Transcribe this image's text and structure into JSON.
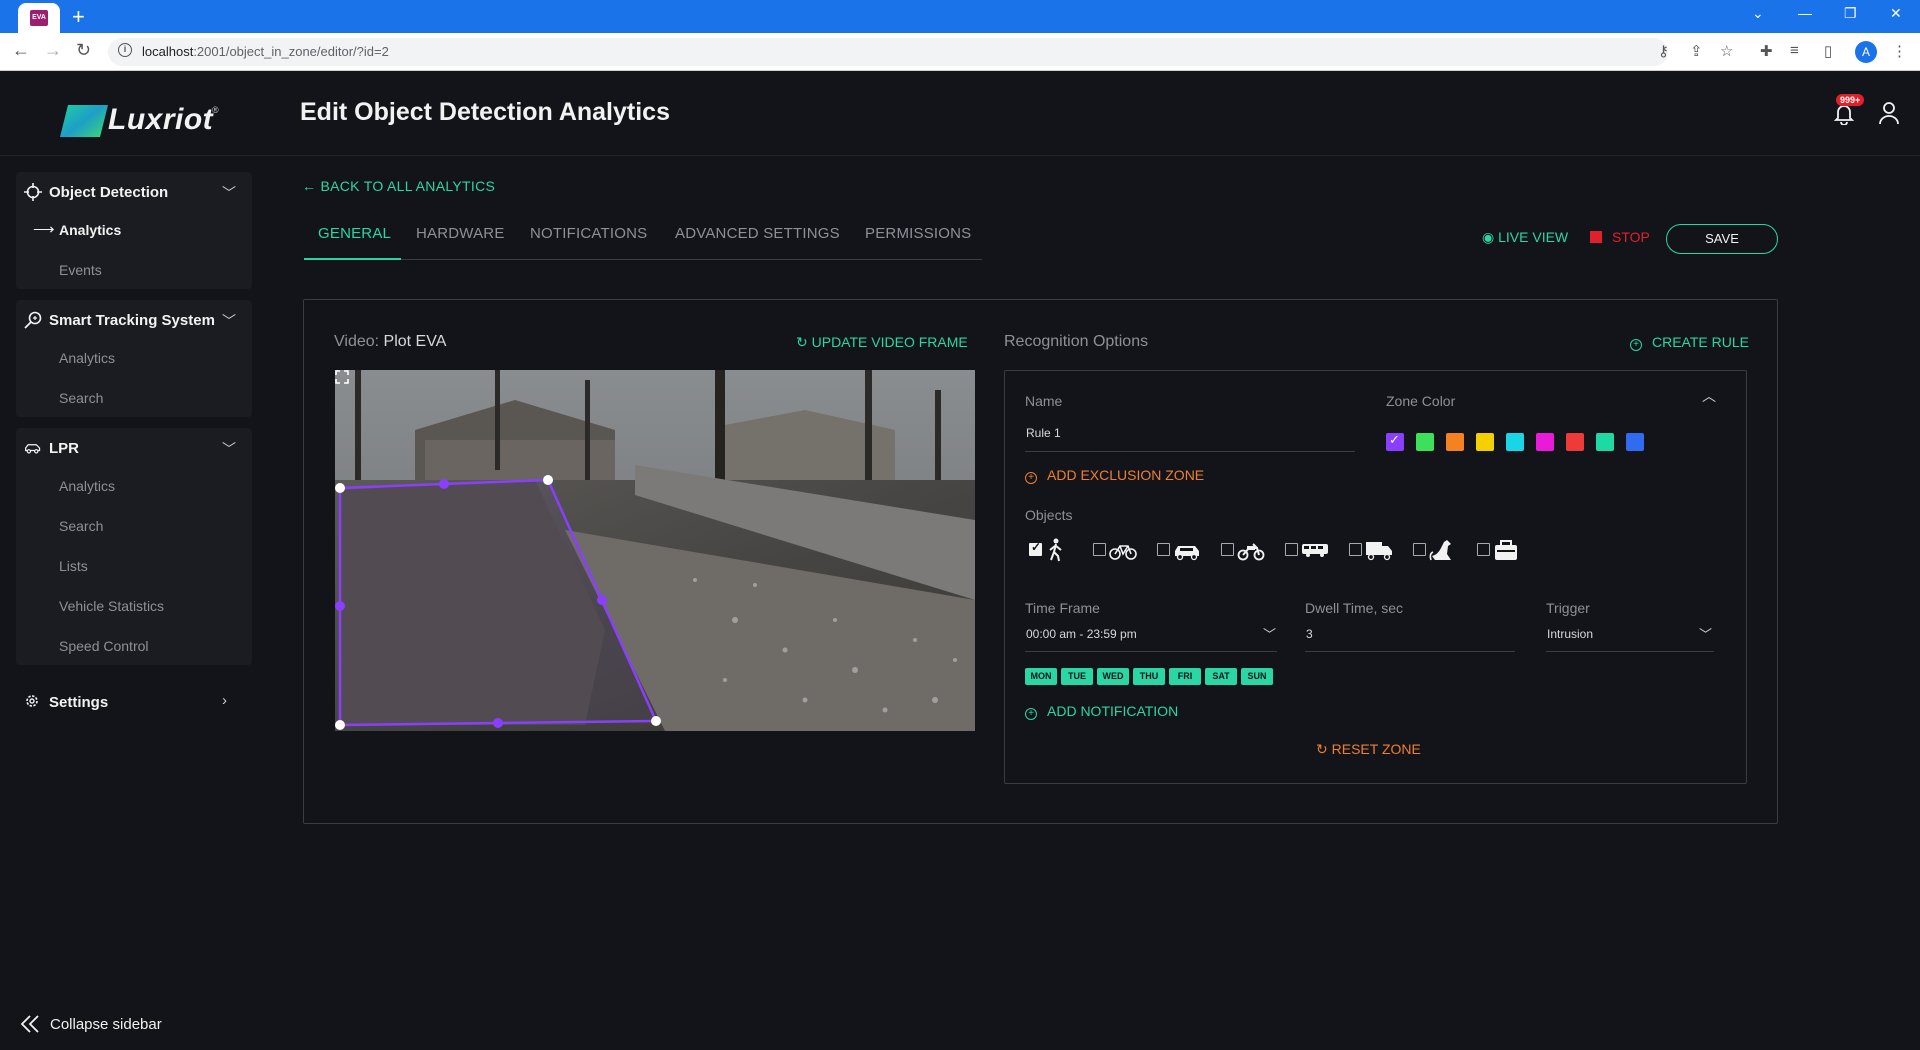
{
  "browser": {
    "tab_favicon": "EVA",
    "url_host": "localhost",
    "url_path": ":2001/object_in_zone/editor/?id=2",
    "profile_initial": "A"
  },
  "header": {
    "logo": "Luxriot",
    "title": "Edit Object Detection Analytics",
    "notification_badge": "999+"
  },
  "sidebar": {
    "groups": [
      {
        "label": "Object Detection",
        "items": [
          {
            "label": "Analytics",
            "active": true
          },
          {
            "label": "Events",
            "active": false
          }
        ]
      },
      {
        "label": "Smart Tracking System",
        "items": [
          {
            "label": "Analytics"
          },
          {
            "label": "Search"
          }
        ]
      },
      {
        "label": "LPR",
        "items": [
          {
            "label": "Analytics"
          },
          {
            "label": "Search"
          },
          {
            "label": "Lists"
          },
          {
            "label": "Vehicle Statistics"
          },
          {
            "label": "Speed Control"
          }
        ]
      }
    ],
    "settings_label": "Settings",
    "collapse_label": "Collapse sidebar"
  },
  "main": {
    "back_link": "BACK TO ALL ANALYTICS",
    "tabs": [
      {
        "label": "GENERAL",
        "active": true
      },
      {
        "label": "HARDWARE"
      },
      {
        "label": "NOTIFICATIONS"
      },
      {
        "label": "ADVANCED SETTINGS"
      },
      {
        "label": "PERMISSIONS"
      }
    ],
    "live_view": "LIVE VIEW",
    "stop": "STOP",
    "save": "SAVE"
  },
  "video": {
    "label": "Video:",
    "name": "Plot EVA",
    "update_frame": "UPDATE VIDEO FRAME"
  },
  "recognition": {
    "title": "Recognition Options",
    "create_rule": "CREATE RULE",
    "name_label": "Name",
    "name_value": "Rule 1",
    "zone_color_label": "Zone Color",
    "zone_colors": [
      "#8a3ffc",
      "#3ce05a",
      "#f58220",
      "#f5d000",
      "#18d6e6",
      "#e81cd8",
      "#ef3a3a",
      "#1ed9a4",
      "#2f6cf0"
    ],
    "selected_color_index": 0,
    "add_exclusion_zone": "ADD EXCLUSION ZONE",
    "objects_label": "Objects",
    "objects": [
      {
        "icon": "pedestrian-icon",
        "checked": true
      },
      {
        "icon": "bicycle-icon",
        "checked": false
      },
      {
        "icon": "car-icon",
        "checked": false
      },
      {
        "icon": "motorcycle-icon",
        "checked": false
      },
      {
        "icon": "bus-icon",
        "checked": false
      },
      {
        "icon": "truck-icon",
        "checked": false
      },
      {
        "icon": "animal-icon",
        "checked": false
      },
      {
        "icon": "bag-icon",
        "checked": false
      }
    ],
    "time_frame_label": "Time Frame",
    "time_frame_value": "00:00 am - 23:59 pm",
    "dwell_label": "Dwell Time, sec",
    "dwell_value": "3",
    "trigger_label": "Trigger",
    "trigger_value": "Intrusion",
    "days": [
      "MON",
      "TUE",
      "WED",
      "THU",
      "FRI",
      "SAT",
      "SUN"
    ],
    "add_notification": "ADD NOTIFICATION",
    "reset_zone": "RESET ZONE"
  },
  "colors": {
    "accent": "#2ad6a3",
    "warning": "#f07f2e",
    "danger": "#e0202a",
    "zone": "#8a3ffc"
  }
}
